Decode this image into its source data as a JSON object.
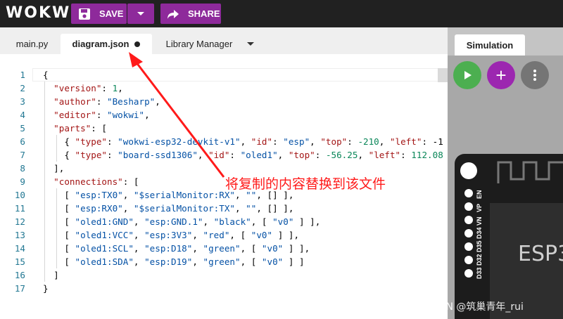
{
  "app": {
    "logo": "WOKWI"
  },
  "toolbar": {
    "save_label": "SAVE",
    "share_label": "SHARE",
    "accent_color": "#8e2a9b"
  },
  "tabs": [
    {
      "label": "main.py"
    },
    {
      "label": "diagram.json",
      "unsaved": true
    },
    {
      "label": "Library Manager"
    }
  ],
  "code_lines": [
    {
      "n": "1",
      "parts": [
        [
          "p",
          "{"
        ]
      ]
    },
    {
      "n": "2",
      "parts": [
        [
          "p",
          "  "
        ],
        [
          "s",
          "\"version\""
        ],
        [
          "p",
          ": "
        ],
        [
          "n",
          "1"
        ],
        [
          "p",
          ","
        ]
      ]
    },
    {
      "n": "3",
      "parts": [
        [
          "p",
          "  "
        ],
        [
          "s",
          "\"author\""
        ],
        [
          "p",
          ": "
        ],
        [
          "k",
          "\"Besharp\""
        ],
        [
          "p",
          ","
        ]
      ]
    },
    {
      "n": "4",
      "parts": [
        [
          "p",
          "  "
        ],
        [
          "s",
          "\"editor\""
        ],
        [
          "p",
          ": "
        ],
        [
          "k",
          "\"wokwi\""
        ],
        [
          "p",
          ","
        ]
      ]
    },
    {
      "n": "5",
      "parts": [
        [
          "p",
          "  "
        ],
        [
          "s",
          "\"parts\""
        ],
        [
          "p",
          ": ["
        ]
      ]
    },
    {
      "n": "6",
      "parts": [
        [
          "p",
          "    { "
        ],
        [
          "s",
          "\"type\""
        ],
        [
          "p",
          ": "
        ],
        [
          "k",
          "\"wokwi-esp32-devkit-v1\""
        ],
        [
          "p",
          ", "
        ],
        [
          "s",
          "\"id\""
        ],
        [
          "p",
          ": "
        ],
        [
          "k",
          "\"esp\""
        ],
        [
          "p",
          ", "
        ],
        [
          "s",
          "\"top\""
        ],
        [
          "p",
          ": "
        ],
        [
          "n",
          "-210"
        ],
        [
          "p",
          ", "
        ],
        [
          "s",
          "\"left\""
        ],
        [
          "p",
          ": -1"
        ]
      ]
    },
    {
      "n": "7",
      "parts": [
        [
          "p",
          "    { "
        ],
        [
          "s",
          "\"type\""
        ],
        [
          "p",
          ": "
        ],
        [
          "k",
          "\"board-ssd1306\""
        ],
        [
          "p",
          ", "
        ],
        [
          "s",
          "\"id\""
        ],
        [
          "p",
          ": "
        ],
        [
          "k",
          "\"oled1\""
        ],
        [
          "p",
          ", "
        ],
        [
          "s",
          "\"top\""
        ],
        [
          "p",
          ": "
        ],
        [
          "n",
          "-56.25"
        ],
        [
          "p",
          ", "
        ],
        [
          "s",
          "\"left\""
        ],
        [
          "p",
          ": "
        ],
        [
          "n",
          "112.08"
        ]
      ]
    },
    {
      "n": "8",
      "parts": [
        [
          "p",
          "  ],"
        ]
      ]
    },
    {
      "n": "9",
      "parts": [
        [
          "p",
          "  "
        ],
        [
          "s",
          "\"connections\""
        ],
        [
          "p",
          ": ["
        ]
      ]
    },
    {
      "n": "10",
      "parts": [
        [
          "p",
          "    [ "
        ],
        [
          "k",
          "\"esp:TX0\""
        ],
        [
          "p",
          ", "
        ],
        [
          "k",
          "\"$serialMonitor:RX\""
        ],
        [
          "p",
          ", "
        ],
        [
          "k",
          "\"\""
        ],
        [
          "p",
          ", [] ],"
        ]
      ]
    },
    {
      "n": "11",
      "parts": [
        [
          "p",
          "    [ "
        ],
        [
          "k",
          "\"esp:RX0\""
        ],
        [
          "p",
          ", "
        ],
        [
          "k",
          "\"$serialMonitor:TX\""
        ],
        [
          "p",
          ", "
        ],
        [
          "k",
          "\"\""
        ],
        [
          "p",
          ", [] ],"
        ]
      ]
    },
    {
      "n": "12",
      "parts": [
        [
          "p",
          "    [ "
        ],
        [
          "k",
          "\"oled1:GND\""
        ],
        [
          "p",
          ", "
        ],
        [
          "k",
          "\"esp:GND.1\""
        ],
        [
          "p",
          ", "
        ],
        [
          "k",
          "\"black\""
        ],
        [
          "p",
          ", [ "
        ],
        [
          "k",
          "\"v0\""
        ],
        [
          "p",
          " ] ],"
        ]
      ]
    },
    {
      "n": "13",
      "parts": [
        [
          "p",
          "    [ "
        ],
        [
          "k",
          "\"oled1:VCC\""
        ],
        [
          "p",
          ", "
        ],
        [
          "k",
          "\"esp:3V3\""
        ],
        [
          "p",
          ", "
        ],
        [
          "k",
          "\"red\""
        ],
        [
          "p",
          ", [ "
        ],
        [
          "k",
          "\"v0\""
        ],
        [
          "p",
          " ] ],"
        ]
      ]
    },
    {
      "n": "14",
      "parts": [
        [
          "p",
          "    [ "
        ],
        [
          "k",
          "\"oled1:SCL\""
        ],
        [
          "p",
          ", "
        ],
        [
          "k",
          "\"esp:D18\""
        ],
        [
          "p",
          ", "
        ],
        [
          "k",
          "\"green\""
        ],
        [
          "p",
          ", [ "
        ],
        [
          "k",
          "\"v0\""
        ],
        [
          "p",
          " ] ],"
        ]
      ]
    },
    {
      "n": "15",
      "parts": [
        [
          "p",
          "    [ "
        ],
        [
          "k",
          "\"oled1:SDA\""
        ],
        [
          "p",
          ", "
        ],
        [
          "k",
          "\"esp:D19\""
        ],
        [
          "p",
          ", "
        ],
        [
          "k",
          "\"green\""
        ],
        [
          "p",
          ", [ "
        ],
        [
          "k",
          "\"v0\""
        ],
        [
          "p",
          " ] ]"
        ]
      ]
    },
    {
      "n": "16",
      "parts": [
        [
          "p",
          "  ]"
        ]
      ]
    },
    {
      "n": "17",
      "parts": [
        [
          "p",
          "}"
        ]
      ]
    }
  ],
  "annotation": {
    "text": "将复制的内容替换到该文件",
    "color": "#ff1a1a"
  },
  "simulation": {
    "tab_label": "Simulation",
    "play_color": "#4caf50",
    "add_color": "#9c27b0",
    "more_color": "#757575",
    "board_label": "ESP3",
    "pins": [
      "EN",
      "VP",
      "VN",
      "D34",
      "D35",
      "D32",
      "D33"
    ]
  },
  "watermark": "CSDN @筑巢青年_rui"
}
